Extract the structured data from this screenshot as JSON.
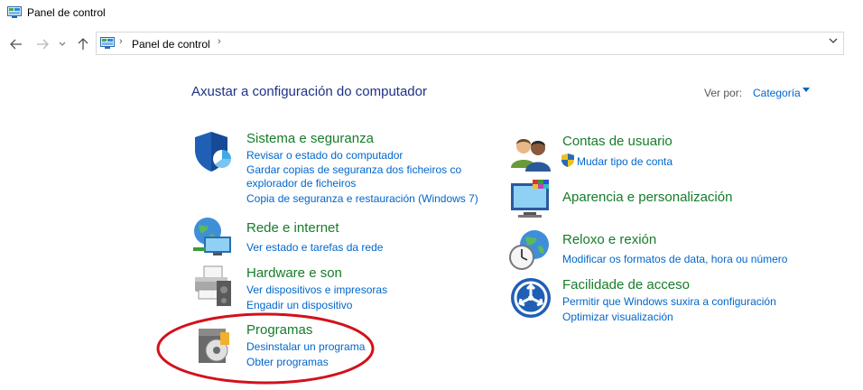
{
  "window": {
    "title": "Panel de control"
  },
  "address": {
    "path": "Panel de control"
  },
  "header": {
    "heading": "Axustar a configuración do computador",
    "view_by_label": "Ver por:",
    "view_by_value": "Categoría"
  },
  "categories": {
    "sistema": {
      "title": "Sistema e seguranza",
      "links": [
        "Revisar o estado do computador",
        "Gardar copias de seguranza dos ficheiros co",
        "explorador de ficheiros",
        "Copia de seguranza e restauración (Windows 7)"
      ]
    },
    "rede": {
      "title": "Rede e internet",
      "links": [
        "Ver estado e tarefas da rede"
      ]
    },
    "hardware": {
      "title": "Hardware e son",
      "links": [
        "Ver dispositivos e impresoras",
        "Engadir un dispositivo"
      ]
    },
    "programas": {
      "title": "Programas",
      "links": [
        "Desinstalar un programa",
        "Obter programas"
      ]
    },
    "contas": {
      "title": "Contas de usuario",
      "links": [
        "Mudar tipo de conta"
      ]
    },
    "aparencia": {
      "title": "Aparencia e personalización",
      "links": []
    },
    "reloxo": {
      "title": "Reloxo e rexión",
      "links": [
        "Modificar os formatos de data, hora ou número"
      ]
    },
    "facilidade": {
      "title": "Facilidade de acceso",
      "links": [
        "Permitir que Windows suxira a configuración",
        "Optimizar visualización"
      ]
    }
  },
  "colors": {
    "category_title": "#157c2a",
    "link": "#0066cc",
    "heading": "#1e3287",
    "annotation": "#d3111b"
  }
}
